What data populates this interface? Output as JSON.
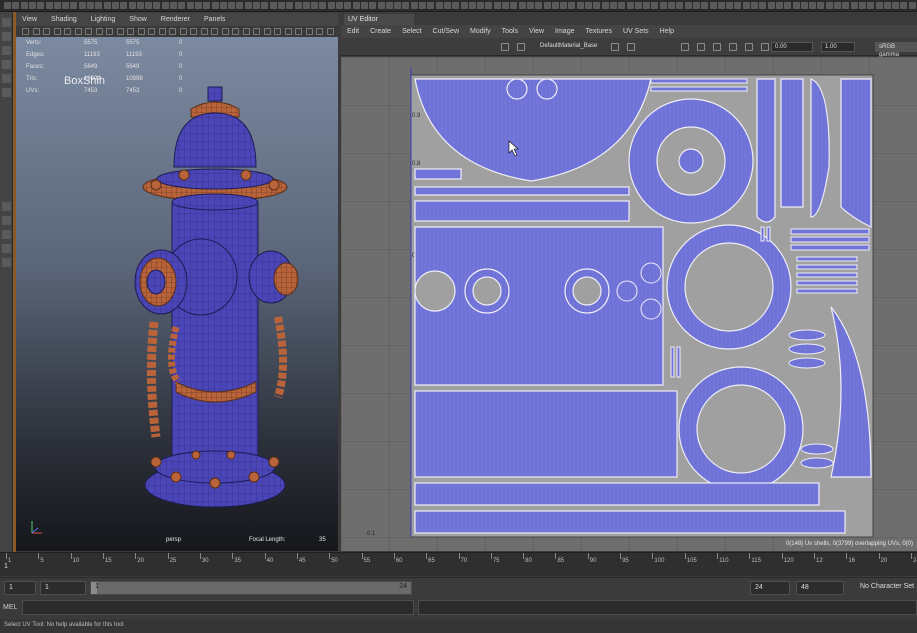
{
  "viewport": {
    "menu": [
      "View",
      "Shading",
      "Lighting",
      "Show",
      "Renderer",
      "Panels"
    ],
    "hud": [
      {
        "label": "Verts:",
        "v1": "5575",
        "v2": "5575",
        "v3": "0"
      },
      {
        "label": "Edges:",
        "v1": "11193",
        "v2": "11193",
        "v3": "0"
      },
      {
        "label": "Faces:",
        "v1": "5649",
        "v2": "5649",
        "v3": "0"
      },
      {
        "label": "Tris:",
        "v1": "10998",
        "v2": "10998",
        "v3": "0"
      },
      {
        "label": "UVs:",
        "v1": "7453",
        "v2": "7453",
        "v3": "0"
      }
    ],
    "watermark": "BoxShih",
    "camera": "persp",
    "focal_label": "Focal Length:",
    "focal_value": "35"
  },
  "uv_editor": {
    "title": "UV Editor",
    "menu": [
      "Edit",
      "Create",
      "Select",
      "Cut/Sew",
      "Modify",
      "Tools",
      "View",
      "Image",
      "Textures",
      "UV Sets",
      "Help"
    ],
    "material": "DefaultMaterial_Base",
    "field_a": "0.00",
    "field_b": "1.00",
    "color_space": "sRGB gamma",
    "status": "0(148) Uv shells, 0(3799) overlapping UVs, 0(0)",
    "grid_labels": [
      "0.9",
      "0.8",
      "0.7",
      "0.1"
    ]
  },
  "timeline": {
    "ticks": [
      "1",
      "5",
      "10",
      "15",
      "20",
      "25",
      "30",
      "35",
      "40",
      "45",
      "50",
      "55",
      "60",
      "65",
      "70",
      "75",
      "80",
      "85",
      "90",
      "95",
      "100",
      "105",
      "110",
      "115",
      "120",
      "12",
      "16",
      "20",
      "24"
    ],
    "current_frame": "1"
  },
  "range": {
    "start": "1",
    "slider_start": "1",
    "slider_start_field": "1",
    "slider_end": "24",
    "anim_end": "24",
    "playback_end": "48",
    "character_set": "No Character Set"
  },
  "command": {
    "label": "MEL",
    "help": "Select UV Tool: No help available for this tool"
  },
  "colors": {
    "uv_shell": "#6f72d6",
    "uv_edge": "#e8e8f8",
    "mesh_blue": "#4a46b8",
    "mesh_orange": "#b8633a"
  }
}
